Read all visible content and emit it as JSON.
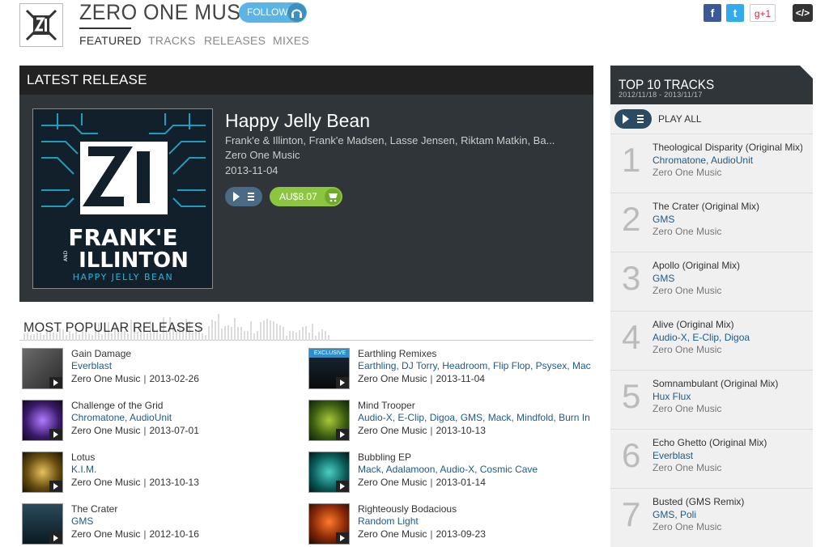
{
  "header": {
    "label_name": "ZERO ONE MUSIC",
    "follow_label": "FOLLOW",
    "tabs": [
      {
        "label": "FEATURED"
      },
      {
        "label": "TRACKS"
      },
      {
        "label": "RELEASES"
      },
      {
        "label": "MIXES"
      }
    ],
    "social": {
      "facebook": "f",
      "twitter": "t",
      "gplus": "g+1",
      "embed": "</>"
    }
  },
  "latest_release": {
    "heading": "LATEST RELEASE",
    "title": "Happy Jelly Bean",
    "artists": "Frank'e & Illinton, Frank'e Madsen, Lasse Jensen, Riktam Matkin, Ba...",
    "label": "Zero One Music",
    "date": "2013-11-04",
    "price": "AU$8.07",
    "cover_text": {
      "main": "FRANK'E",
      "sub": "ILLINTON",
      "tag": "HAPPY JELLY BEAN",
      "and": "AND"
    }
  },
  "most_popular": {
    "heading": "MOST POPULAR RELEASES",
    "releases": [
      {
        "title": "Gain Damage",
        "artists": "Everblast",
        "label": "Zero One Music",
        "date": "2013-02-26"
      },
      {
        "title": "Earthling Remixes",
        "artists": "Earthling, DJ Torry, Headroom, Flip Flop, Psysex, Mac",
        "label": "Zero One Music",
        "date": "2013-11-04",
        "badge": "EXCLUSIVE"
      },
      {
        "title": "Challenge of the Grid",
        "artists": "Chromatone, AudioUnit",
        "label": "Zero One Music",
        "date": "2013-07-01"
      },
      {
        "title": "Mind Trooper",
        "artists": "Audio-X, E-Clip, Digoa, GMS, Mack, Mindfold, Burn In",
        "label": "Zero One Music",
        "date": "2013-10-13"
      },
      {
        "title": "Lotus",
        "artists": "K.I.M.",
        "label": "Zero One Music",
        "date": "2013-10-13"
      },
      {
        "title": "Bubbling EP",
        "artists": "Mack, Adalamoon, Audio-X, Cosmic Cave",
        "label": "Zero One Music",
        "date": "2013-01-14"
      },
      {
        "title": "The Crater",
        "artists": "GMS",
        "label": "Zero One Music",
        "date": "2012-10-16"
      },
      {
        "title": "Righteously Bodacious",
        "artists": "Random Light",
        "label": "Zero One Music",
        "date": "2013-09-23"
      }
    ]
  },
  "top10": {
    "heading": "TOP 10 TRACKS",
    "range": "2012/11/18 - 2013/11/17",
    "play_all": "PLAY ALL",
    "tracks": [
      {
        "num": "1",
        "title": "Theological Disparity (Original Mix)",
        "artists": "Chromatone, AudioUnit",
        "label": "Zero One Music"
      },
      {
        "num": "2",
        "title": "The Crater (Original Mix)",
        "artists": "GMS",
        "label": "Zero One Music"
      },
      {
        "num": "3",
        "title": "Apollo (Original Mix)",
        "artists": "GMS",
        "label": "Zero One Music"
      },
      {
        "num": "4",
        "title": "Alive (Original Mix)",
        "artists": "Audio-X, E-Clip, Digoa",
        "label": "Zero One Music"
      },
      {
        "num": "5",
        "title": "Somnambulant (Original Mix)",
        "artists": "Hux Flux",
        "label": "Zero One Music"
      },
      {
        "num": "6",
        "title": "Echo Ghetto (Original Mix)",
        "artists": "Everblast",
        "label": "Zero One Music"
      },
      {
        "num": "7",
        "title": "Busted (GMS Remix)",
        "artists": "GMS, Poli",
        "label": "Zero One Music"
      }
    ]
  },
  "colors": {
    "accent": "#5ab4e6",
    "price": "#8cc63f",
    "link": "#1e5a8a",
    "panel": "#2f3538"
  }
}
